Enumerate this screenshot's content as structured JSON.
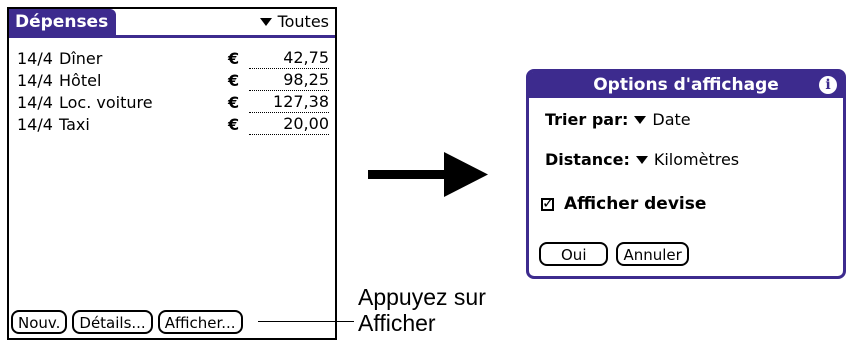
{
  "left_screen": {
    "title": "Dépenses",
    "category": "Toutes",
    "expenses": [
      {
        "date": "14/4",
        "description": "Dîner",
        "currency": "€",
        "amount": "42,75"
      },
      {
        "date": "14/4",
        "description": "Hôtel",
        "currency": "€",
        "amount": "98,25"
      },
      {
        "date": "14/4",
        "description": "Loc. voiture",
        "currency": "€",
        "amount": "127,38"
      },
      {
        "date": "14/4",
        "description": "Taxi",
        "currency": "€",
        "amount": "20,00"
      }
    ],
    "buttons": {
      "new": "Nouv.",
      "details": "Détails...",
      "show": "Afficher..."
    }
  },
  "callout": {
    "line1": "Appuyez sur",
    "line2": "Afficher"
  },
  "dialog": {
    "title": "Options d'affichage",
    "info_icon": "i",
    "sort_label": "Trier par:",
    "sort_value": "Date",
    "distance_label": "Distance:",
    "distance_value": "Kilomètres",
    "show_currency_label": "Afficher devise",
    "show_currency_checked": true,
    "ok": "Oui",
    "cancel": "Annuler"
  },
  "colors": {
    "accent": "#3d2b8e"
  },
  "icons": {
    "dropdown": "triangle-down-icon",
    "info": "info-icon",
    "arrow": "right-arrow-icon",
    "check": "checkbox-icon"
  }
}
